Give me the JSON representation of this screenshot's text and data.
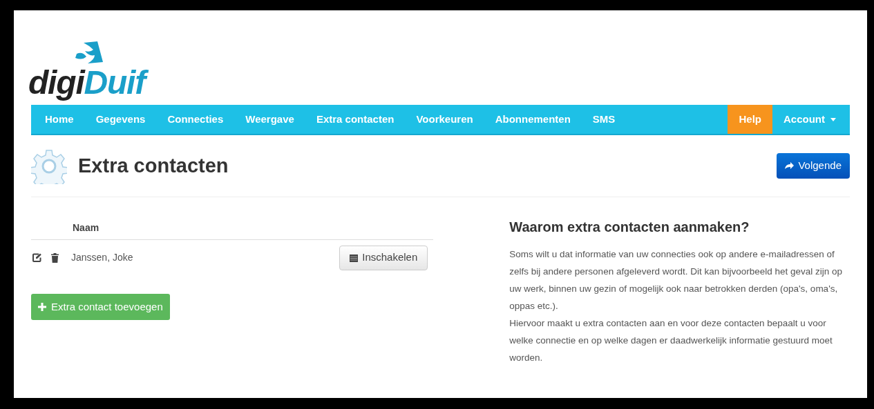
{
  "logo": {
    "prefix": "digi",
    "brand": "Duif"
  },
  "nav": [
    {
      "label": "Home",
      "kind": "link"
    },
    {
      "label": "Gegevens",
      "kind": "link"
    },
    {
      "label": "Connecties",
      "kind": "link"
    },
    {
      "label": "Weergave",
      "kind": "link"
    },
    {
      "label": "Extra contacten",
      "kind": "link"
    },
    {
      "label": "Voorkeuren",
      "kind": "link"
    },
    {
      "label": "Abonnementen",
      "kind": "link"
    },
    {
      "label": "SMS",
      "kind": "link"
    },
    {
      "label": "Help",
      "kind": "highlight"
    },
    {
      "label": "Account",
      "kind": "dropdown"
    }
  ],
  "page": {
    "title": "Extra contacten",
    "next_button": "Volgende"
  },
  "table": {
    "columns": [
      "Naam"
    ],
    "rows": [
      {
        "name": "Janssen, Joke",
        "action": "Inschakelen"
      }
    ]
  },
  "add_button": "Extra contact toevoegen",
  "info": {
    "heading": "Waarom extra contacten aanmaken?",
    "paragraphs": [
      "Soms wilt u dat informatie van uw connecties ook op andere e-mailadressen of zelfs bij andere personen afgeleverd wordt. Dit kan bijvoorbeeld het geval zijn op uw werk, binnen uw gezin of mogelijk ook naar betrokken derden (opa's, oma's, oppas etc.).",
      "Hiervoor maakt u extra contacten aan en voor deze contacten bepaalt u voor welke connectie en op welke dagen er daadwerkelijk informatie gestuurd moet worden."
    ]
  }
}
